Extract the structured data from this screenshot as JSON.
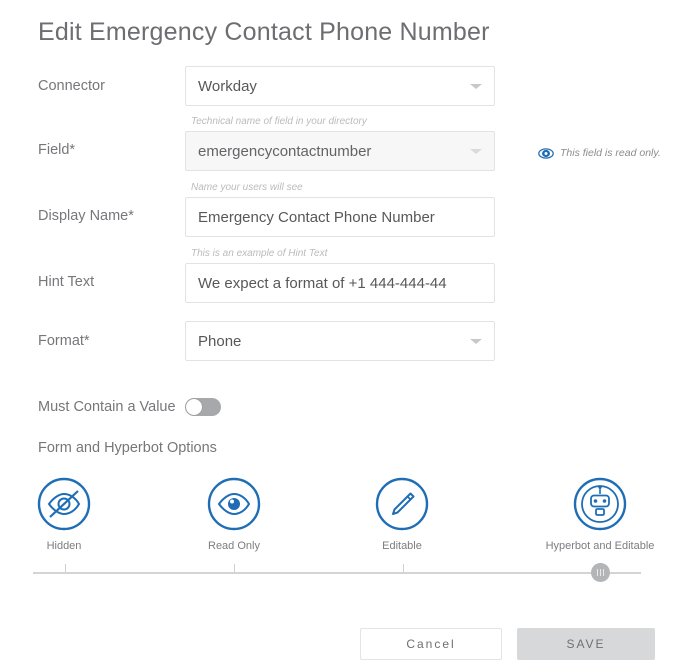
{
  "title": "Edit Emergency Contact Phone Number",
  "fields": [
    {
      "label": "Connector",
      "helper": "",
      "value": "Workday",
      "type": "select",
      "disabled": false,
      "name": "connector"
    },
    {
      "label": "Field*",
      "helper": "Technical name of field in your directory",
      "value": "emergencycontactnumber",
      "type": "select",
      "disabled": true,
      "name": "field"
    },
    {
      "label": "Display Name*",
      "helper": "Name your users will see",
      "value": "Emergency Contact Phone Number",
      "type": "text",
      "disabled": false,
      "name": "display-name"
    },
    {
      "label": "Hint Text",
      "helper": "This is an example of Hint Text",
      "value": "We expect a format of +1 444-444-44",
      "type": "text",
      "disabled": false,
      "name": "hint-text"
    },
    {
      "label": "Format*",
      "helper": "",
      "value": "Phone",
      "type": "select",
      "disabled": false,
      "name": "format"
    }
  ],
  "readonly_note": {
    "icon": "eye-icon",
    "text": "This field is read only."
  },
  "must_contain": {
    "label": "Must Contain a Value",
    "state": "off"
  },
  "options_section": {
    "title": "Form and Hyperbot Options",
    "options": [
      {
        "label": "Hidden",
        "icon": "eye-off-icon"
      },
      {
        "label": "Read Only",
        "icon": "eye-icon"
      },
      {
        "label": "Editable",
        "icon": "pencil-icon"
      },
      {
        "label": "Hyperbot and Editable",
        "icon": "robot-icon"
      }
    ],
    "slider_selected_index": 3
  },
  "buttons": {
    "cancel": "Cancel",
    "save": "SAVE"
  },
  "colors": {
    "accent": "#1f6eb5",
    "text": "#58585b",
    "label": "#76777a",
    "helper": "#b9bbbd",
    "border": "#e2e3e5",
    "disabled_bg": "#f7f7f8",
    "save_bg": "#d7d8da",
    "toggle_track": "#a6a8ab",
    "slider_handle": "#b4b5b7"
  }
}
